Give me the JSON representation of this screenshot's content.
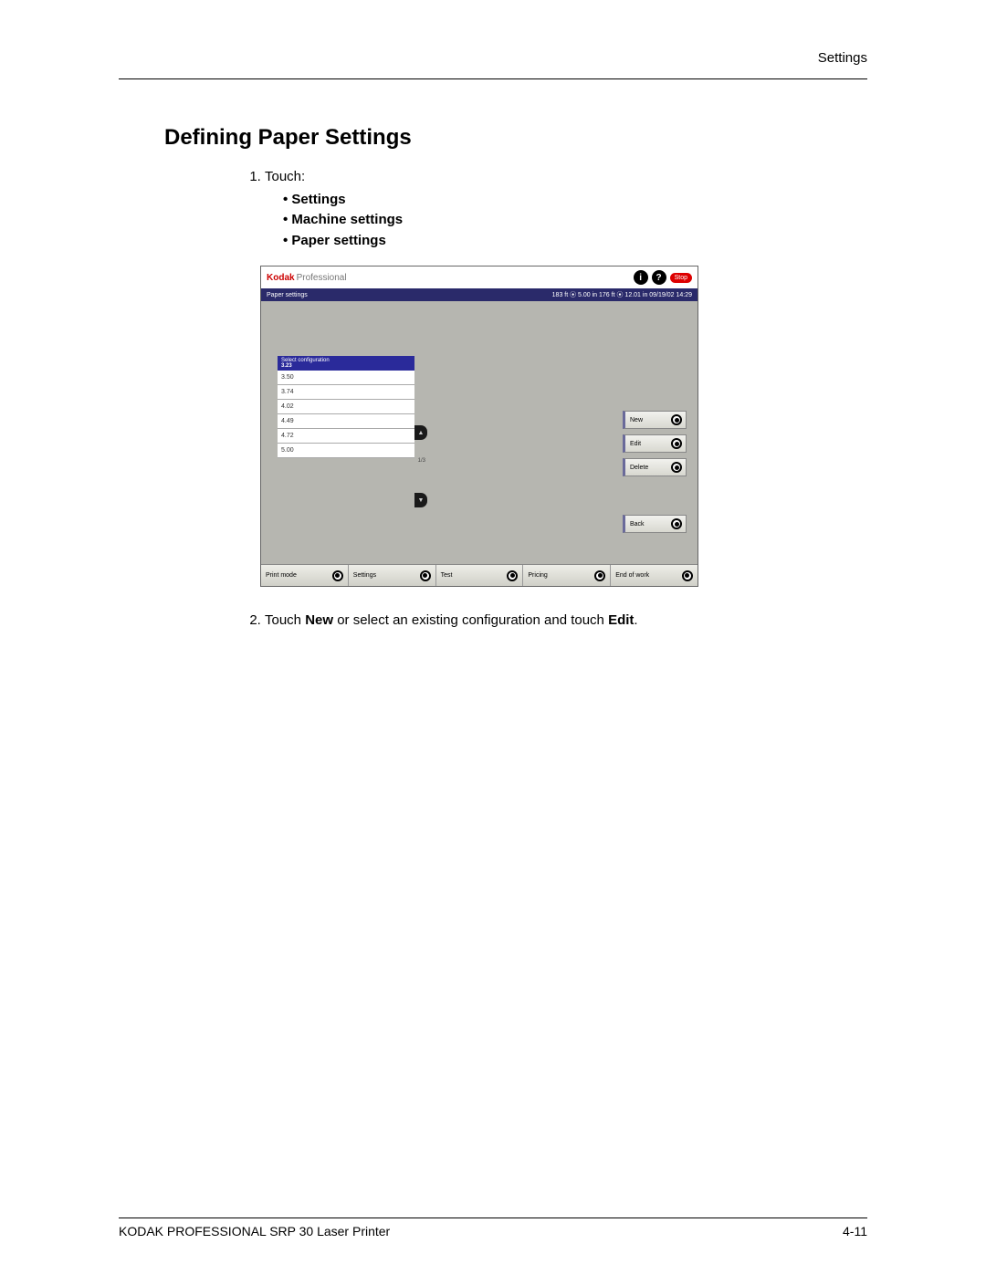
{
  "header": {
    "section_label": "Settings"
  },
  "title": "Defining Paper Settings",
  "step1": {
    "lead": "Touch:",
    "items": [
      "Settings",
      "Machine settings",
      "Paper settings"
    ]
  },
  "screenshot": {
    "brand_kodak": "Kodak",
    "brand_prof": "Professional",
    "info_glyph": "i",
    "help_glyph": "?",
    "stop_label": "Stop",
    "status_left": "Paper settings",
    "status_right": "183 ft ⦿ 5.00 in   176 ft ⦿ 12.01 in   09/19/02    14:29",
    "config_header_line1": "Select configuration",
    "config_selected": "3.23",
    "config_rows": [
      "3.50",
      "3.74",
      "4.02",
      "4.49",
      "4.72",
      "5.00"
    ],
    "page_indicator": "1/3",
    "side_buttons": {
      "new": "New",
      "edit": "Edit",
      "delete": "Delete",
      "back": "Back"
    },
    "bottom": {
      "print_mode": "Print mode",
      "settings": "Settings",
      "test": "Test",
      "pricing": "Pricing",
      "end_of_work": "End of work"
    }
  },
  "step2": {
    "prefix": "Touch ",
    "b1": "New",
    "mid": " or select an existing configuration and touch ",
    "b2": "Edit",
    "suffix": "."
  },
  "footer": {
    "left": "KODAK PROFESSIONAL SRP 30 Laser Printer",
    "right": "4-11"
  }
}
